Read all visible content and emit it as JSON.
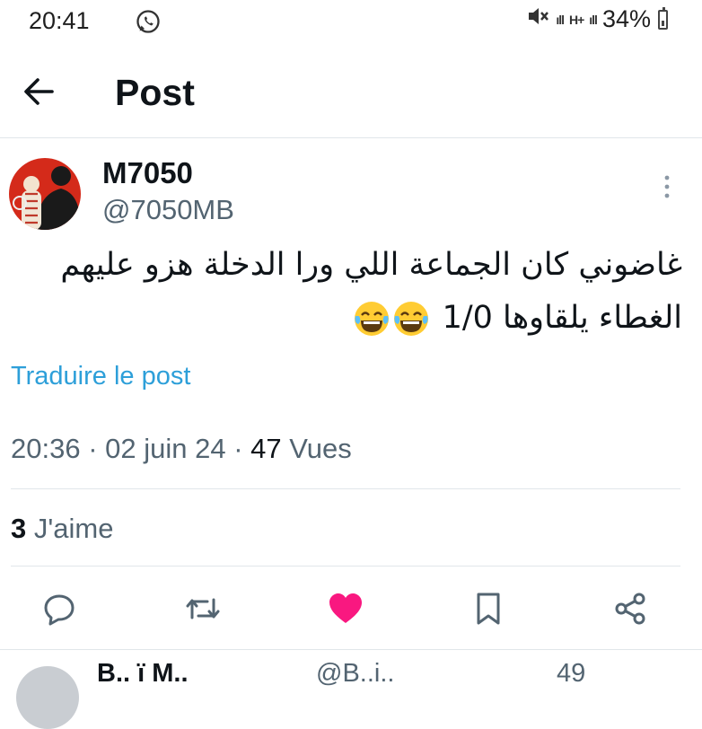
{
  "status_bar": {
    "time": "20:41",
    "battery": "34%",
    "signal": "ıll",
    "network": "H+"
  },
  "header": {
    "title": "Post"
  },
  "post": {
    "author_name": "M7050",
    "author_handle": "@7050MB",
    "text_line1": "غاضوني كان الجماعة اللي ورا الدخلة هزو عليهم",
    "text_line2": "الغطاء يلقاوها 1/0",
    "translate_label": "Traduire le post",
    "time": "20:36",
    "date": "02 juin 24",
    "views_count": "47",
    "views_label": "Vues",
    "likes_count": "3",
    "likes_label": "J'aime",
    "liked": true,
    "like_color": "#f91880"
  },
  "reply_peek": {
    "name": "B.. ï M..",
    "handle": "@B..i..",
    "time": "49"
  },
  "icons": [
    "whatsapp-icon",
    "mute-icon",
    "signal-icon",
    "battery-icon",
    "back-arrow-icon",
    "more-icon",
    "reply-icon",
    "retweet-icon",
    "heart-icon",
    "bookmark-icon",
    "share-icon"
  ]
}
